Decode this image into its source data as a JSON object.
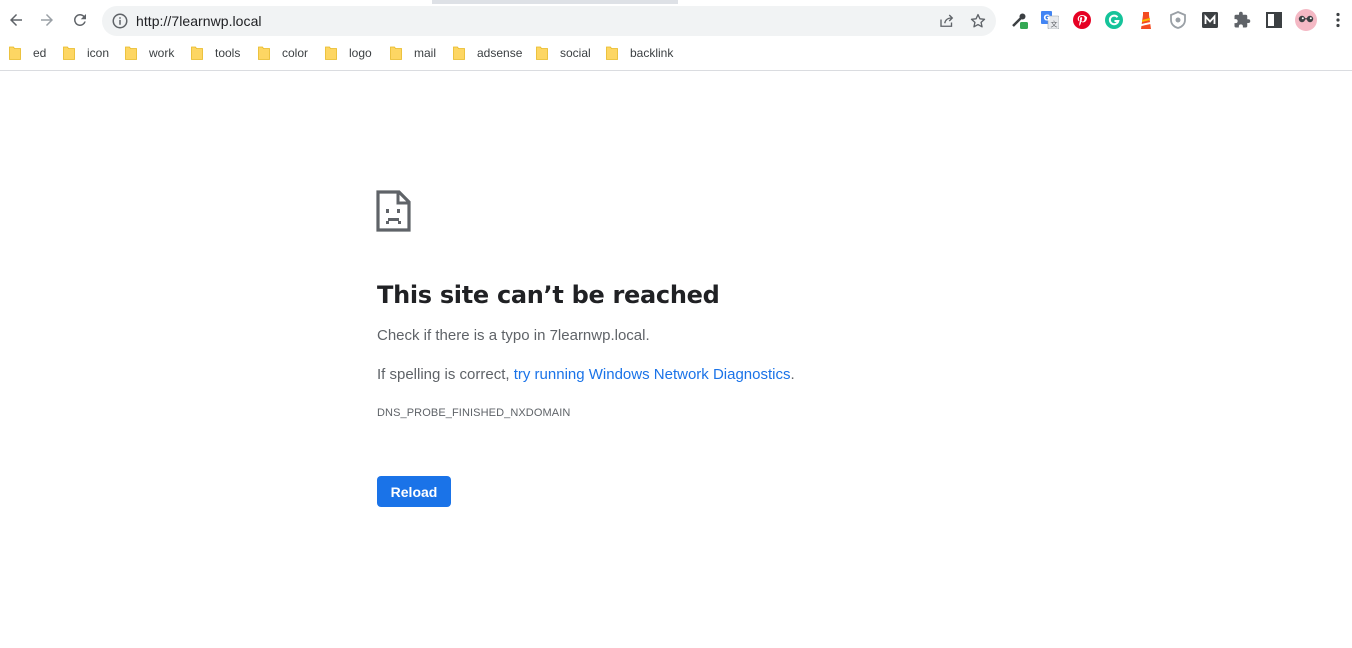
{
  "toolbar": {
    "url": "http://7learnwp.local",
    "back_icon": "arrow-left-icon",
    "forward_icon": "arrow-right-icon",
    "reload_icon": "reload-icon"
  },
  "bookmarks": [
    {
      "label": "ed"
    },
    {
      "label": "icon"
    },
    {
      "label": "work"
    },
    {
      "label": "tools"
    },
    {
      "label": "color"
    },
    {
      "label": "logo"
    },
    {
      "label": "mail"
    },
    {
      "label": "adsense"
    },
    {
      "label": "social"
    },
    {
      "label": "backlink"
    }
  ],
  "extensions": [
    "color-picker-icon",
    "google-translate-icon",
    "pinterest-icon",
    "grammarly-icon",
    "lighthouse-icon",
    "shield-icon",
    "m-icon",
    "puzzle-icon",
    "side-panel-icon",
    "profile-avatar-icon",
    "menu-dots-icon"
  ],
  "error": {
    "headline": "This site can’t be reached",
    "line1": "Check if there is a typo in 7learnwp.local.",
    "line2_prefix": "If spelling is correct, ",
    "line2_link": "try running Windows Network Diagnostics",
    "line2_suffix": ".",
    "code": "DNS_PROBE_FINISHED_NXDOMAIN",
    "reload_label": "Reload"
  },
  "colors": {
    "accent": "#1a73e8",
    "omnibox_bg": "#f1f3f4",
    "folder": "#fdd663"
  }
}
